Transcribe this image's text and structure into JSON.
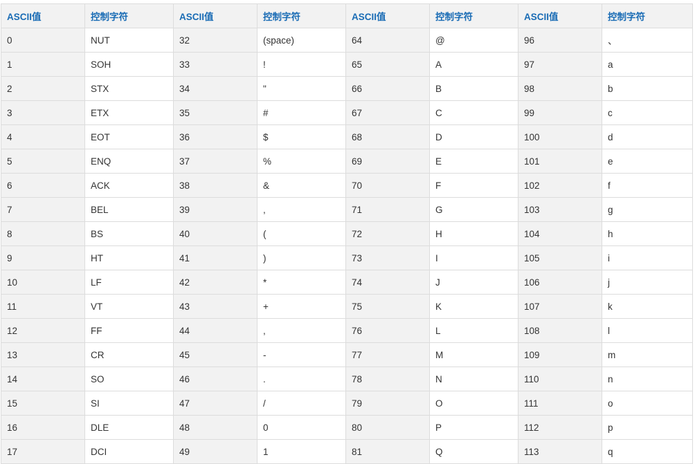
{
  "headers": [
    "ASCII值",
    "控制字符",
    "ASCII值",
    "控制字符",
    "ASCII值",
    "控制字符",
    "ASCII值",
    "控制字符"
  ],
  "rows": [
    [
      "0",
      "NUT",
      "32",
      "(space)",
      "64",
      "@",
      "96",
      "、"
    ],
    [
      "1",
      "SOH",
      "33",
      "!",
      "65",
      "A",
      "97",
      "a"
    ],
    [
      "2",
      "STX",
      "34",
      "\"",
      "66",
      "B",
      "98",
      "b"
    ],
    [
      "3",
      "ETX",
      "35",
      "#",
      "67",
      "C",
      "99",
      "c"
    ],
    [
      "4",
      "EOT",
      "36",
      "$",
      "68",
      "D",
      "100",
      "d"
    ],
    [
      "5",
      "ENQ",
      "37",
      "%",
      "69",
      "E",
      "101",
      "e"
    ],
    [
      "6",
      "ACK",
      "38",
      "&",
      "70",
      "F",
      "102",
      "f"
    ],
    [
      "7",
      "BEL",
      "39",
      ",",
      "71",
      "G",
      "103",
      "g"
    ],
    [
      "8",
      "BS",
      "40",
      "(",
      "72",
      "H",
      "104",
      "h"
    ],
    [
      "9",
      "HT",
      "41",
      ")",
      "73",
      "I",
      "105",
      "i"
    ],
    [
      "10",
      "LF",
      "42",
      "*",
      "74",
      "J",
      "106",
      "j"
    ],
    [
      "11",
      "VT",
      "43",
      "+",
      "75",
      "K",
      "107",
      "k"
    ],
    [
      "12",
      "FF",
      "44",
      ",",
      "76",
      "L",
      "108",
      "l"
    ],
    [
      "13",
      "CR",
      "45",
      "-",
      "77",
      "M",
      "109",
      "m"
    ],
    [
      "14",
      "SO",
      "46",
      ".",
      "78",
      "N",
      "110",
      "n"
    ],
    [
      "15",
      "SI",
      "47",
      "/",
      "79",
      "O",
      "111",
      "o"
    ],
    [
      "16",
      "DLE",
      "48",
      "0",
      "80",
      "P",
      "112",
      "p"
    ],
    [
      "17",
      "DCI",
      "49",
      "1",
      "81",
      "Q",
      "113",
      "q"
    ]
  ]
}
